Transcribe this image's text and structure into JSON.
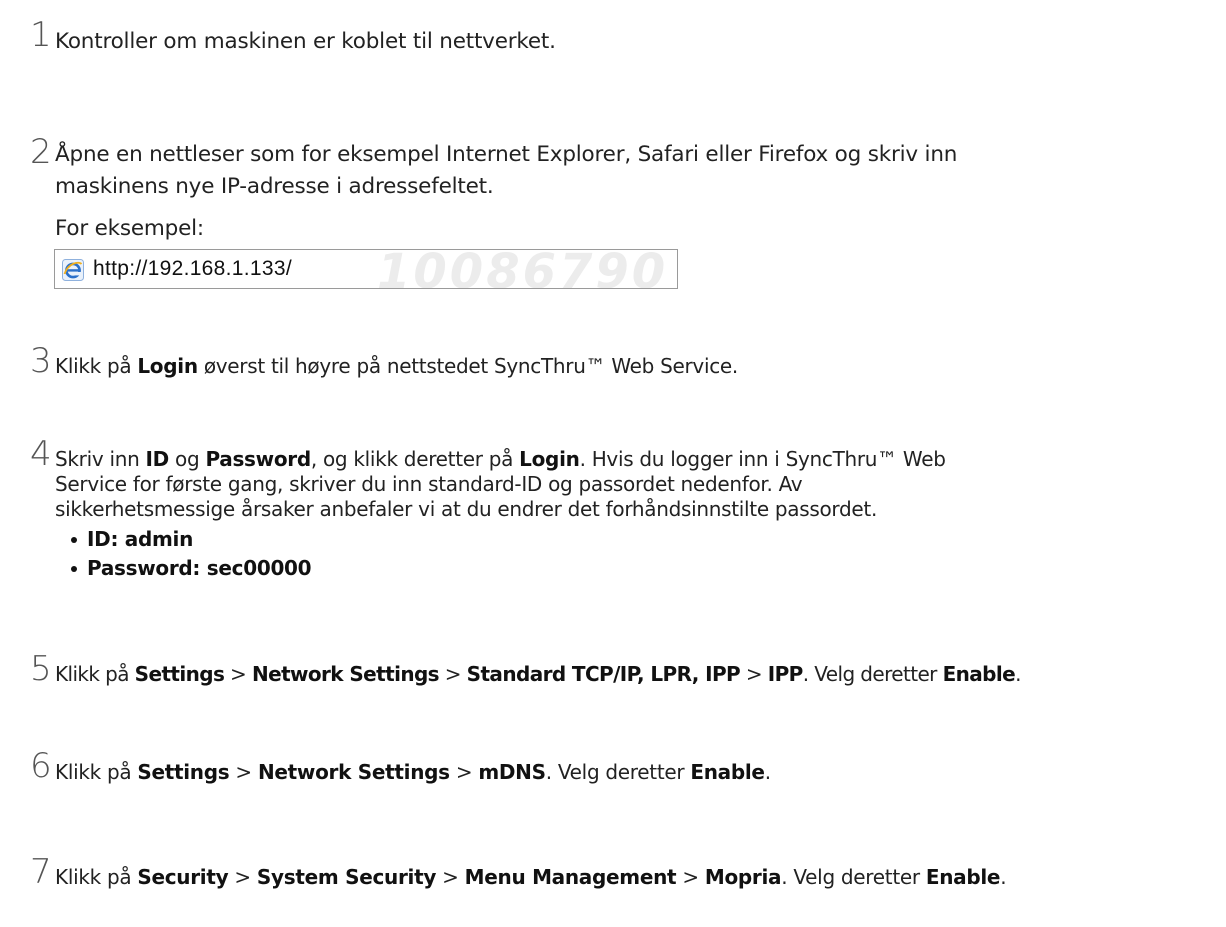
{
  "steps": [
    {
      "number": "1",
      "text": "Kontroller om maskinen er koblet til nettverket."
    },
    {
      "number": "2",
      "line1": "Åpne en nettleser som for eksempel Internet Explorer, Safari eller Firefox og skriv inn",
      "line2": "maskinens nye IP-adresse i adressefeltet.",
      "example_label": "For eksempel:",
      "address_bar": {
        "icon": "internet-explorer-icon",
        "url": "http://192.168.1.133/",
        "watermark": "10086790"
      }
    },
    {
      "number": "3",
      "pre": "Klikk på ",
      "b1": "Login",
      "post": " øverst til høyre på nettstedet SyncThru™ Web Service."
    },
    {
      "number": "4",
      "t1": "Skriv inn ",
      "b1": "ID",
      "t2": " og ",
      "b2": "Password",
      "t3": ", og klikk deretter på ",
      "b3": "Login",
      "t4": ". Hvis du logger inn i SyncThru™ Web",
      "line2": "Service for første gang, skriver du inn standard-ID og passordet nedenfor. Av",
      "line3": "sikkerhetsmessige årsaker anbefaler vi at du endrer det forhåndsinnstilte passordet.",
      "bullets": [
        "ID: admin",
        "Password: sec00000"
      ]
    },
    {
      "number": "5",
      "t1": "Klikk på ",
      "b1": "Settings",
      "sep1": " > ",
      "b2": "Network Settings",
      "sep2": " > ",
      "b3": "Standard TCP/IP, LPR, IPP",
      "sep3": " > ",
      "b4": "IPP",
      "t2": ". Velg deretter ",
      "b5": "Enable",
      "t3": "."
    },
    {
      "number": "6",
      "t1": "Klikk på ",
      "b1": "Settings",
      "sep1": " > ",
      "b2": "Network Settings",
      "sep2": " > ",
      "b3": "mDNS",
      "t2": ". Velg deretter ",
      "b4": "Enable",
      "t3": "."
    },
    {
      "number": "7",
      "t1": "Klikk på ",
      "b1": "Security",
      "sep1": " > ",
      "b2": "System Security",
      "sep2": " > ",
      "b3": "Menu Management",
      "sep3": " > ",
      "b4": "Mopria",
      "t2": ". Velg deretter ",
      "b5": "Enable",
      "t3": "."
    }
  ],
  "colors": {
    "text": "#222222",
    "step_number": "#555555",
    "ie_icon_blue": "#2a6fc9"
  }
}
